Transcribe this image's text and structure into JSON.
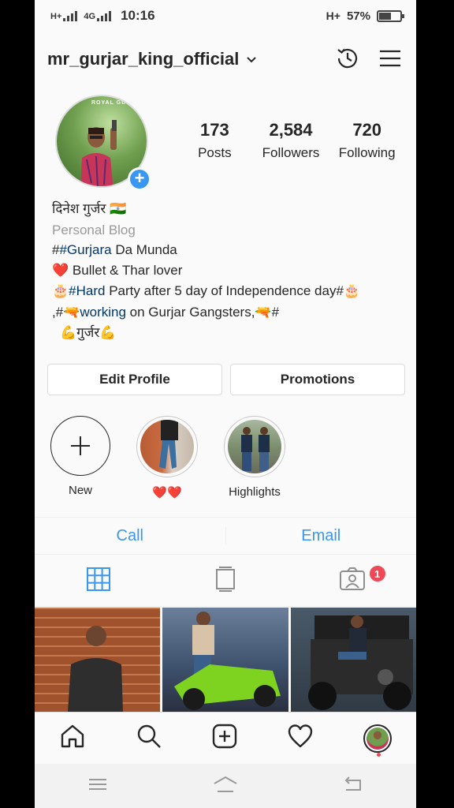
{
  "status_bar": {
    "sim1": "H+",
    "sim2": "4G",
    "time": "10:16",
    "network_right": "H+",
    "battery_percent": "57%",
    "battery_level": 0.57
  },
  "header": {
    "username": "mr_gurjar_king_official",
    "icons": [
      "chevron-down-icon",
      "history-icon",
      "menu-icon"
    ]
  },
  "profile": {
    "stats": [
      {
        "value": "173",
        "label": "Posts"
      },
      {
        "value": "2,584",
        "label": "Followers"
      },
      {
        "value": "720",
        "label": "Following"
      }
    ],
    "avatar_text": "ROYAL GU"
  },
  "bio": {
    "name": "दिनेश गुर्जर",
    "flag": "🇮🇳",
    "category": "Personal Blog",
    "line1_prefix": "#",
    "line1_tag": "#Gurjara",
    "line1_rest": " Da Munda",
    "line2_emoji": "❤️",
    "line2_text": " Bullet & Thar lover",
    "line3_emoji": "🎂",
    "line3_tag": "#Hard",
    "line3_text": " Party after 5 day of Independence day#",
    "line3_emoji_end": "🎂",
    "line4_prefix": ",#",
    "line4_gun": "🔫",
    "line4_tag": "working",
    "line4_text": " on Gurjar Gangsters,",
    "line4_gun2": "🔫",
    "line4_end": "#",
    "line5_arm1": "💪",
    "line5_text": "गुर्जर",
    "line5_arm2": "💪"
  },
  "buttons": {
    "edit_profile": "Edit Profile",
    "promotions": "Promotions"
  },
  "highlights": [
    {
      "label": "New"
    },
    {
      "label": "❤️❤️"
    },
    {
      "label": "Highlights"
    }
  ],
  "contact": {
    "call": "Call",
    "email": "Email"
  },
  "tabs": {
    "items": [
      "grid-icon",
      "igtv-icon",
      "tagged-icon"
    ],
    "tagged_badge": "1"
  },
  "colors": {
    "accent_blue": "#3897f0",
    "notification_red": "#ed4956",
    "hashtag": "#003569"
  }
}
